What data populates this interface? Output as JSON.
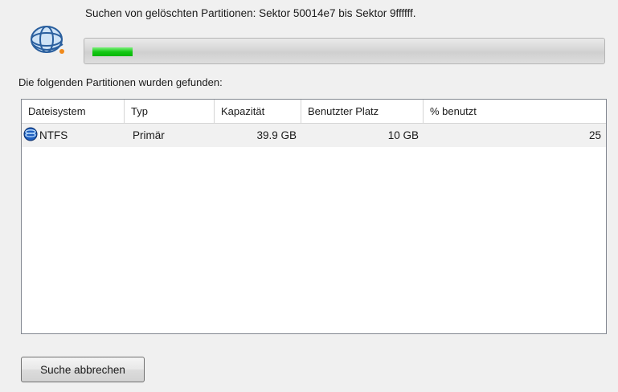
{
  "status": {
    "text": "Suchen von gelöschten Partitionen: Sektor 50014e7 bis Sektor 9ffffff.",
    "progress_fraction": 0.08
  },
  "found_label": "Die folgenden Partitionen wurden gefunden:",
  "table": {
    "columns": [
      "Dateisystem",
      "Typ",
      "Kapazität",
      "Benutzter Platz",
      "% benutzt"
    ],
    "rows": [
      {
        "filesystem": "NTFS",
        "type": "Primär",
        "capacity": "39.9 GB",
        "used": "10 GB",
        "percent_used": "25",
        "icon": "disk-icon"
      }
    ]
  },
  "buttons": {
    "cancel_label": "Suche abbrechen"
  },
  "colors": {
    "progress_green": "#14c814",
    "row_highlight": "#f1f1f1"
  }
}
